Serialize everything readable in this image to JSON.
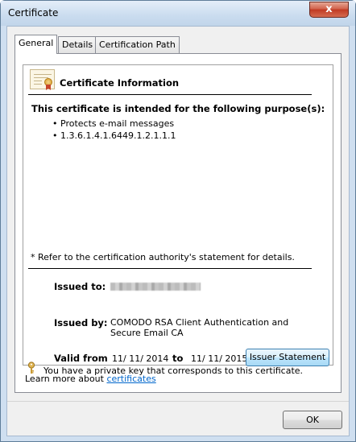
{
  "window": {
    "title": "Certificate",
    "close_glyph": "x"
  },
  "tabs": [
    {
      "label": "General",
      "active": true
    },
    {
      "label": "Details",
      "active": false
    },
    {
      "label": "Certification Path",
      "active": false
    }
  ],
  "info": {
    "icon": "certificate-icon",
    "title": "Certificate Information",
    "purpose_heading": "This certificate is intended for the following purpose(s):",
    "purposes": [
      "Protects e-mail messages",
      "1.3.6.1.4.1.6449.1.2.1.1.1"
    ],
    "refer_note": "* Refer to the certification authority's statement for details.",
    "issued_to_label": "Issued to:",
    "issued_to_value_redacted": true,
    "issued_by_label": "Issued by:",
    "issued_by_value": "COMODO RSA Client Authentication and Secure Email CA",
    "valid_from_label": "Valid from",
    "valid_from": "11/ 11/ 2014",
    "valid_to_label": "to",
    "valid_to": "11/ 11/ 2015",
    "key_icon": "key-icon",
    "private_key_note": "You have a private key that corresponds to this certificate."
  },
  "buttons": {
    "issuer_statement": "Issuer Statement",
    "ok": "OK"
  },
  "learn_more": {
    "prefix": "Learn more about ",
    "link": "certificates"
  },
  "colors": {
    "link": "#0066cc",
    "close_button": "#c8442b"
  }
}
